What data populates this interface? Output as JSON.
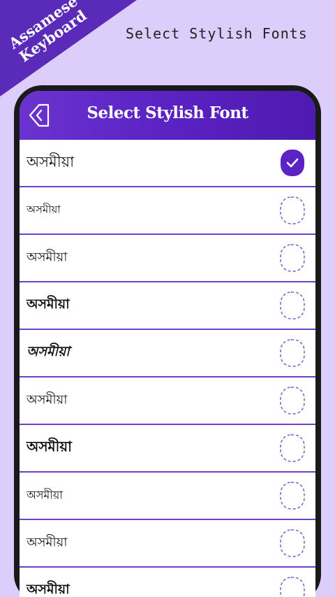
{
  "banner": {
    "line1": "Assamese",
    "line2": "Keyboard",
    "headline": "Select Stylish Fonts"
  },
  "appbar": {
    "title": "Select Stylish Font",
    "back_icon": "back-chevron-icon"
  },
  "colors": {
    "background": "#dccdfb",
    "accent": "#5b22c4",
    "divider": "#6b3fcf",
    "radio_dashed": "#7c5bd6"
  },
  "font_options": [
    {
      "label": "অসমীয়া",
      "selected": true
    },
    {
      "label": "অসমীয়া",
      "selected": false
    },
    {
      "label": "অসমীয়া",
      "selected": false
    },
    {
      "label": "অসমীয়া",
      "selected": false
    },
    {
      "label": "অসমীয়া",
      "selected": false
    },
    {
      "label": "অসমীয়া",
      "selected": false
    },
    {
      "label": "অসমীয়া",
      "selected": false
    },
    {
      "label": "অসমীয়া",
      "selected": false
    },
    {
      "label": "অসমীয়া",
      "selected": false
    },
    {
      "label": "অসমীয়া",
      "selected": false
    }
  ]
}
